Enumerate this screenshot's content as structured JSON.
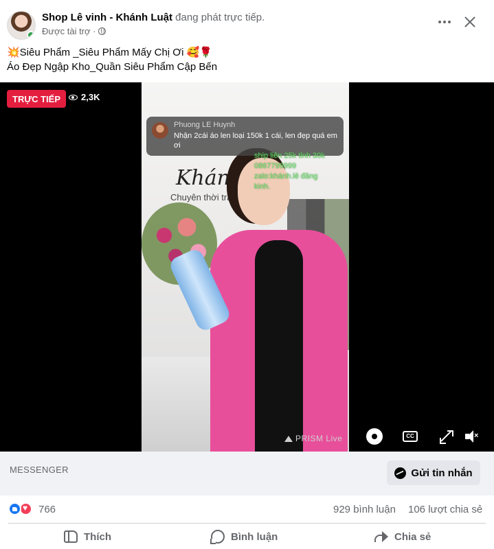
{
  "post": {
    "page_name": "Shop Lê vinh - Khánh Luật",
    "live_status": "đang phát trực tiếp.",
    "sponsored": "Được tài trợ ·",
    "caption_line1": "💥Siêu Phẩm _Siêu Phẩm Mấy Chị Ơi 🥰🌹",
    "caption_line2": "Áo Đẹp Ngập Kho_Quần Siêu Phẩm Cập Bến"
  },
  "video": {
    "live_badge": "TRỰC TIẾP",
    "viewers": "2,3K",
    "wall_brand": "Khánh",
    "wall_subtitle": "Chuyên thời tran",
    "comment": {
      "author": "Phuong LE Huynh",
      "text": "Nhận 2cái áo len  loại 150k 1 cái, len đẹp quá em ơi"
    },
    "overlay_text": [
      "ship liên 25k tỉnh 30k",
      "0867799999",
      "zalo:khánh.lê đăng",
      "kinh."
    ],
    "watermark": "PRISM Live",
    "cc_label": "CC",
    "mute_label": "×"
  },
  "messenger": {
    "label": "MESSENGER",
    "button_label": "Gửi tin nhắn"
  },
  "stats": {
    "reactions": "766",
    "comments": "929 bình luận",
    "shares": "106 lượt chia sẻ"
  },
  "actions": {
    "like": "Thích",
    "comment": "Bình luận",
    "share": "Chia sẻ"
  },
  "colors": {
    "live_red": "#e41e3f",
    "like_blue": "#1877f2",
    "love_red": "#f33e58",
    "online_green": "#31a24c"
  }
}
